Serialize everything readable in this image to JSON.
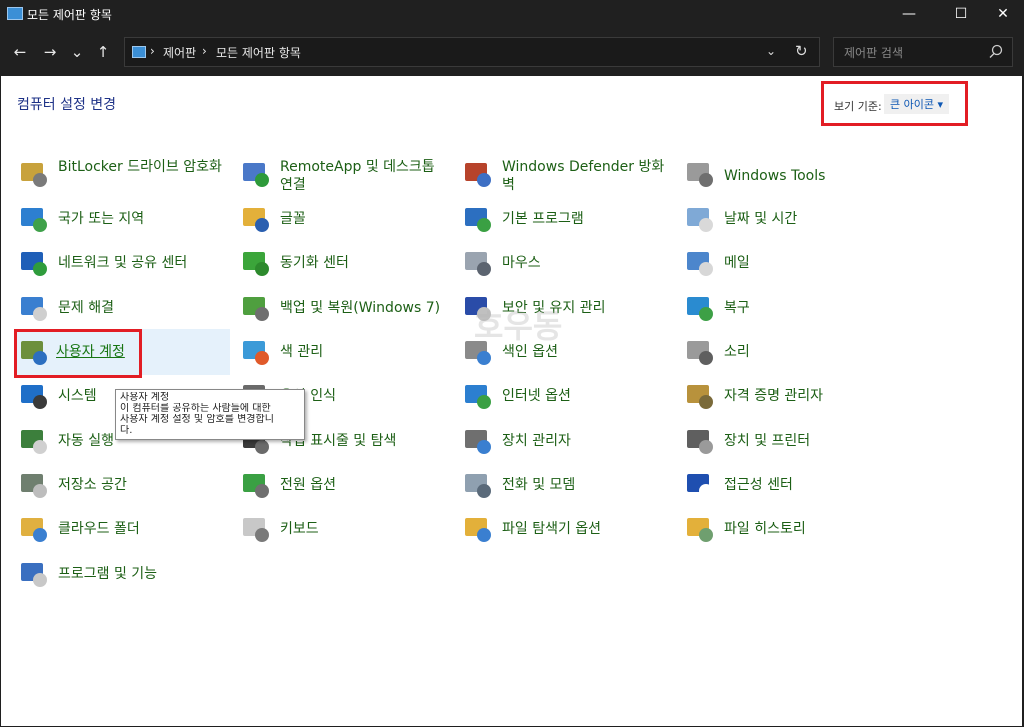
{
  "window": {
    "title": "모든 제어판 항목",
    "minimize": "—",
    "maximize": "☐",
    "close": "✕"
  },
  "nav": {
    "back": "←",
    "forward": "→",
    "recent": "⌄",
    "up": "↑"
  },
  "address": {
    "sep": "›",
    "crumbs": [
      "제어판",
      "모든 제어판 항목"
    ],
    "dropdown": "⌄",
    "refresh": "↻"
  },
  "search": {
    "placeholder": "제어판 검색"
  },
  "header": {
    "title": "컴퓨터 설정 변경",
    "viewby_label": "보기 기준:",
    "viewby_value": "큰 아이콘 ▾"
  },
  "items": [
    {
      "label": "BitLocker 드라이브 암호화",
      "icon": "bitlocker-icon"
    },
    {
      "label": "RemoteApp 및 데스크톱 연결",
      "icon": "remoteapp-icon"
    },
    {
      "label": "Windows Defender 방화벽",
      "icon": "firewall-icon"
    },
    {
      "label": "Windows Tools",
      "icon": "tools-gear-icon"
    },
    {
      "label": "국가 또는 지역",
      "icon": "globe-icon"
    },
    {
      "label": "글꼴",
      "icon": "font-icon"
    },
    {
      "label": "기본 프로그램",
      "icon": "default-programs-icon"
    },
    {
      "label": "날짜 및 시간",
      "icon": "calendar-clock-icon"
    },
    {
      "label": "네트워크 및 공유 센터",
      "icon": "network-icon"
    },
    {
      "label": "동기화 센터",
      "icon": "sync-icon"
    },
    {
      "label": "마우스",
      "icon": "mouse-icon"
    },
    {
      "label": "메일",
      "icon": "mail-icon"
    },
    {
      "label": "문제 해결",
      "icon": "troubleshoot-icon"
    },
    {
      "label": "백업 및 복원(Windows 7)",
      "icon": "backup-icon"
    },
    {
      "label": "보안 및 유지 관리",
      "icon": "security-flag-icon"
    },
    {
      "label": "복구",
      "icon": "recovery-icon"
    },
    {
      "label": "사용자 계정",
      "icon": "user-accounts-icon"
    },
    {
      "label": "색 관리",
      "icon": "color-management-icon"
    },
    {
      "label": "색인 옵션",
      "icon": "indexing-icon"
    },
    {
      "label": "소리",
      "icon": "speaker-icon"
    },
    {
      "label": "시스템",
      "icon": "system-monitor-icon"
    },
    {
      "label": "음성 인식",
      "icon": "microphone-icon"
    },
    {
      "label": "인터넷 옵션",
      "icon": "internet-options-icon"
    },
    {
      "label": "자격 증명 관리자",
      "icon": "credential-vault-icon"
    },
    {
      "label": "자동 실행",
      "icon": "autoplay-icon"
    },
    {
      "label": "작업 표시줄 및 탐색",
      "icon": "taskbar-icon"
    },
    {
      "label": "장치 관리자",
      "icon": "device-manager-icon"
    },
    {
      "label": "장치 및 프린터",
      "icon": "printer-icon"
    },
    {
      "label": "저장소 공간",
      "icon": "storage-spaces-icon"
    },
    {
      "label": "전원 옵션",
      "icon": "power-options-icon"
    },
    {
      "label": "전화 및 모뎀",
      "icon": "phone-modem-icon"
    },
    {
      "label": "접근성 센터",
      "icon": "accessibility-icon"
    },
    {
      "label": "클라우드 폴더",
      "icon": "cloud-folder-icon"
    },
    {
      "label": "키보드",
      "icon": "keyboard-icon"
    },
    {
      "label": "파일 탐색기 옵션",
      "icon": "folder-options-icon"
    },
    {
      "label": "파일 히스토리",
      "icon": "file-history-icon"
    },
    {
      "label": "프로그램 및 기능",
      "icon": "programs-features-icon"
    }
  ],
  "tooltip": {
    "title": "사용자 계정",
    "line1": "이 컴퓨터를 공유하는 사람들에 대한",
    "line2": "사용자 계정 설정 및 암호를 변경합니",
    "line3": "다."
  },
  "watermark": "호우동"
}
